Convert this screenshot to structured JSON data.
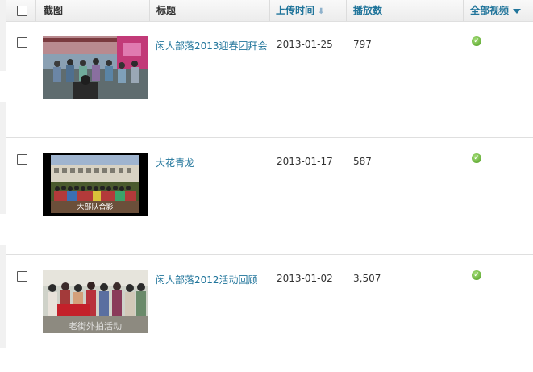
{
  "header": {
    "col_thumbnail": "截图",
    "col_title": "标题",
    "col_upload_time": "上传时间",
    "col_plays": "播放数",
    "col_all_videos": "全部视频"
  },
  "icons": {
    "sort": "arrow-down-icon",
    "filter": "triangle-down-icon",
    "status": "check-circle-icon"
  },
  "colors": {
    "link": "#21759b",
    "status_ok": "#4c9a1f",
    "header_bg": "#ececec"
  },
  "rows": [
    {
      "title": "闲人部落2013迎春团拜会",
      "date": "2013-01-25",
      "plays": "797"
    },
    {
      "title": "大花青龙",
      "date": "2013-01-17",
      "plays": "587",
      "thumb_caption": "大部队合影"
    },
    {
      "title": "闲人部落2012活动回顾",
      "date": "2013-01-02",
      "plays": "3,507",
      "thumb_caption": "老街外拍活动"
    }
  ]
}
